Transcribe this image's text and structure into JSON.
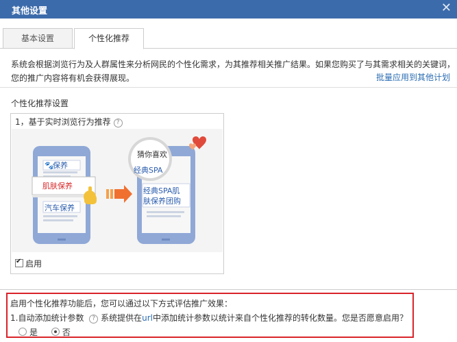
{
  "window": {
    "title": "其他设置",
    "close_label": "✕"
  },
  "tabs": [
    {
      "label": "基本设置",
      "active": false
    },
    {
      "label": "个性化推荐",
      "active": true
    }
  ],
  "description": {
    "line1": "系统会根据浏览行为及人群属性来分析网民的个性化需求，为其推荐相关推广结果。如果您购买了与其需求相关的关键词，",
    "line2": "您的推广内容将有机会获得展现。"
  },
  "bulk_apply_link": "批量应用到其他计划",
  "section_title": "个性化推荐设置",
  "card": {
    "header": "1，基于实时浏览行为推荐",
    "help_icon": "question-circle-icon",
    "enable_label": "启用",
    "enable_checked": true,
    "illustration": {
      "left_phone_items": [
        "保养",
        "肌肤保养",
        "汽车保养"
      ],
      "bubble_text": "猜你喜欢",
      "bubble_subtext": "经典SPA",
      "right_phone_line1": "经典SPA肌",
      "right_phone_line2": "肤保养团购"
    }
  },
  "eval_box": {
    "line1": "启用个性化推荐功能后，您可以通过以下方式评估推广效果：",
    "line2_label": "1.自动添加统计参数",
    "line2_prefix": "系统提供在",
    "line2_url": "url",
    "line2_suffix": "中添加统计参数以统计来自个性化推荐的转化数量。您是否愿意启用？",
    "options": [
      {
        "label": "是",
        "checked": false
      },
      {
        "label": "否",
        "checked": true
      }
    ]
  },
  "colors": {
    "header": "#3c6bab",
    "link": "#2b6db3",
    "highlight_border": "#d9232a"
  }
}
